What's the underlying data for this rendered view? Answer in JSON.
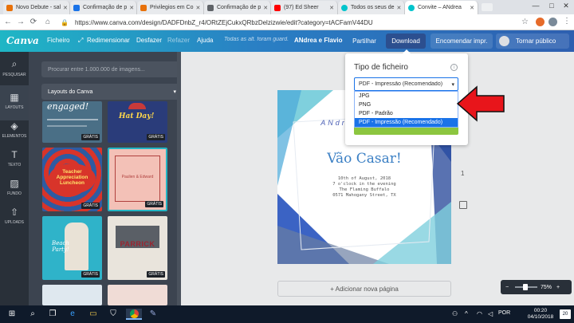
{
  "browser": {
    "tabs": [
      {
        "title": "Novo Debute - sal",
        "favicon_color": "#e8710a"
      },
      {
        "title": "Confirmação de p",
        "favicon_color": "#1a73e8"
      },
      {
        "title": "Privilegios em Co",
        "favicon_color": "#e8710a"
      },
      {
        "title": "Confirmação de p",
        "favicon_color": "#5f6368"
      },
      {
        "title": "(97) Ed Sheer",
        "favicon_color": "#ff0000"
      },
      {
        "title": "Todos os seus de",
        "favicon_color": "#00c4cc"
      },
      {
        "title": "Convite – ANdrea",
        "favicon_color": "#00c4cc"
      }
    ],
    "url": "https://www.canva.com/design/DADFDnbZ_r4/ORtZEjCukxQRbzDelzizwie/edit?category=tACFamV44DU",
    "secure_label": "",
    "window_controls": [
      "—",
      "□",
      "✕"
    ]
  },
  "header": {
    "logo": "Canva",
    "menu": [
      "Ficheiro",
      "Redimensionar",
      "Desfazer",
      "Refazer",
      "Ajuda"
    ],
    "saved_status": "Todas as alt. foram guard.",
    "title": "ANdrea e Flavio",
    "share_label": "Partilhar",
    "download_label": "Download",
    "order_label": "Encomendar impr.",
    "public_label": "Tornar público"
  },
  "sidebar": {
    "items": [
      {
        "label": "PESQUISAR",
        "icon": "search-icon",
        "glyph": "⌕"
      },
      {
        "label": "LAYOUTS",
        "icon": "layouts-icon",
        "glyph": "▦"
      },
      {
        "label": "ELEMENTOS",
        "icon": "elements-icon",
        "glyph": "◈"
      },
      {
        "label": "TEXTO",
        "icon": "text-icon",
        "glyph": "T"
      },
      {
        "label": "FUNDO",
        "icon": "background-icon",
        "glyph": "▨"
      },
      {
        "label": "UPLOADS",
        "icon": "upload-icon",
        "glyph": "⇧"
      }
    ]
  },
  "panel": {
    "search_placeholder": "Procurar entre 1.000.000 de imagens...",
    "layout_select": "Layouts do Canva",
    "thumbnails": [
      {
        "text": "engaged!",
        "badge": "GRÁTIS",
        "bg": "#4a6f86",
        "fg": "#ffffff"
      },
      {
        "text": "Hat Day!",
        "badge": "GRÁTIS",
        "bg": "#2a3c7a",
        "fg": "#ffd84a"
      },
      {
        "text": "Teacher Appreciation Luncheon",
        "badge": "GRÁTIS",
        "bg": "#d8342a",
        "fg": "#ffe36a"
      },
      {
        "text": "Paulien & Edward",
        "badge": "GRÁTIS",
        "bg": "#f3c1b7",
        "fg": "#b0413e"
      },
      {
        "text": "Beach Party!",
        "badge": "GRÁTIS",
        "bg": "#2fb3c9",
        "fg": "#ffffff"
      },
      {
        "text": "PARRICK",
        "badge": "GRÁTIS",
        "bg": "#e9e4dc",
        "fg": "#9a2530"
      }
    ]
  },
  "popup": {
    "title": "Tipo de ficheiro",
    "info_icon": "info-icon",
    "selected": "PDF - Impressão (Recomendado)",
    "options": [
      "JPG",
      "PNG",
      "PDF - Padrão",
      "PDF - Impressão (Recomendado)"
    ]
  },
  "design": {
    "heading": "ANdrea e Flavio",
    "title": "Vão Casar!",
    "details": [
      "10th of August, 2018",
      "7 o'clock in the evening",
      "The Flaming Buffalo",
      "0571 Mahogany Street, TX"
    ],
    "page_number": "1",
    "add_page_label": "+ Adicionar nova página"
  },
  "zoom": {
    "minus": "−",
    "value": "75%",
    "plus": "+"
  },
  "taskbar": {
    "time": "00:20",
    "date": "04/10/2018",
    "lang": "POR",
    "notifications": "20"
  },
  "colors": {
    "arrow": "#e8151b",
    "download_button": "#2c4f8f",
    "selected_option": "#1a73e8",
    "canva_teal": "#1fb6c5"
  }
}
